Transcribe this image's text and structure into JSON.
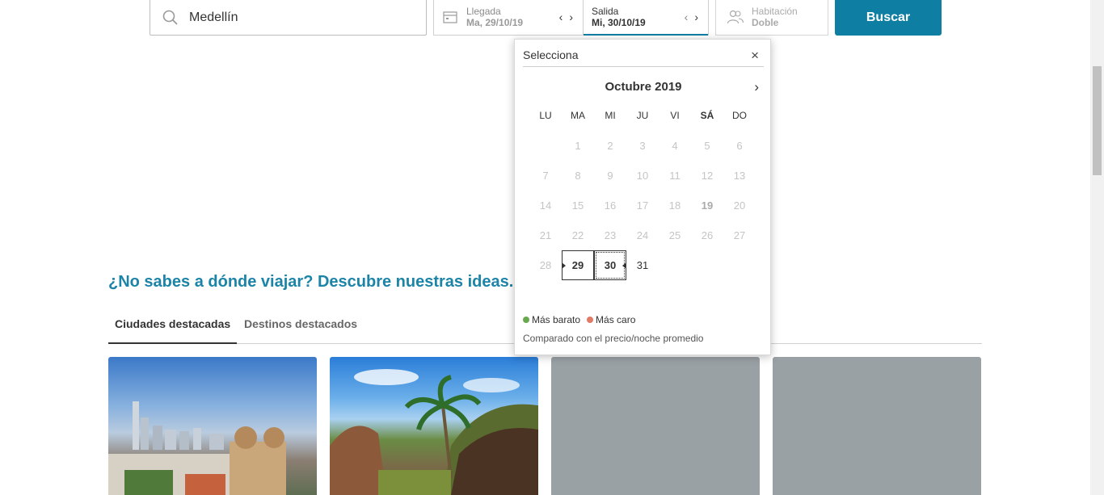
{
  "search": {
    "destination": "Medellín",
    "checkin_label": "Llegada",
    "checkin_value": "Ma, 29/10/19",
    "checkout_label": "Salida",
    "checkout_value": "Mi, 30/10/19",
    "room_label": "Habitación",
    "room_value": "Doble",
    "button": "Buscar",
    "prev_arrow": "‹",
    "next_arrow": "›"
  },
  "calendar": {
    "header": "Selecciona",
    "close": "×",
    "month": "Octubre 2019",
    "next": "›",
    "weekdays": [
      "LU",
      "MA",
      "MI",
      "JU",
      "VI",
      "SÁ",
      "DO"
    ],
    "weeks": [
      [
        "",
        "1",
        "2",
        "3",
        "4",
        "5",
        "6"
      ],
      [
        "7",
        "8",
        "9",
        "10",
        "11",
        "12",
        "13"
      ],
      [
        "14",
        "15",
        "16",
        "17",
        "18",
        "19",
        "20"
      ],
      [
        "21",
        "22",
        "23",
        "24",
        "25",
        "26",
        "27"
      ],
      [
        "28",
        "29",
        "30",
        "31",
        "",
        "",
        ""
      ]
    ],
    "legend_cheap": "Más barato",
    "legend_expensive": "Más caro",
    "note": "Comparado con el precio/noche promedio",
    "cheap_color": "#6aa84f",
    "expensive_color": "#e07b67"
  },
  "discover": {
    "headline": "¿No sabes a dónde viajar? Descubre nuestras ideas.",
    "tab_cities": "Ciudades destacadas",
    "tab_destinations": "Destinos destacados"
  },
  "colors": {
    "accent": "#0f7ea3"
  }
}
